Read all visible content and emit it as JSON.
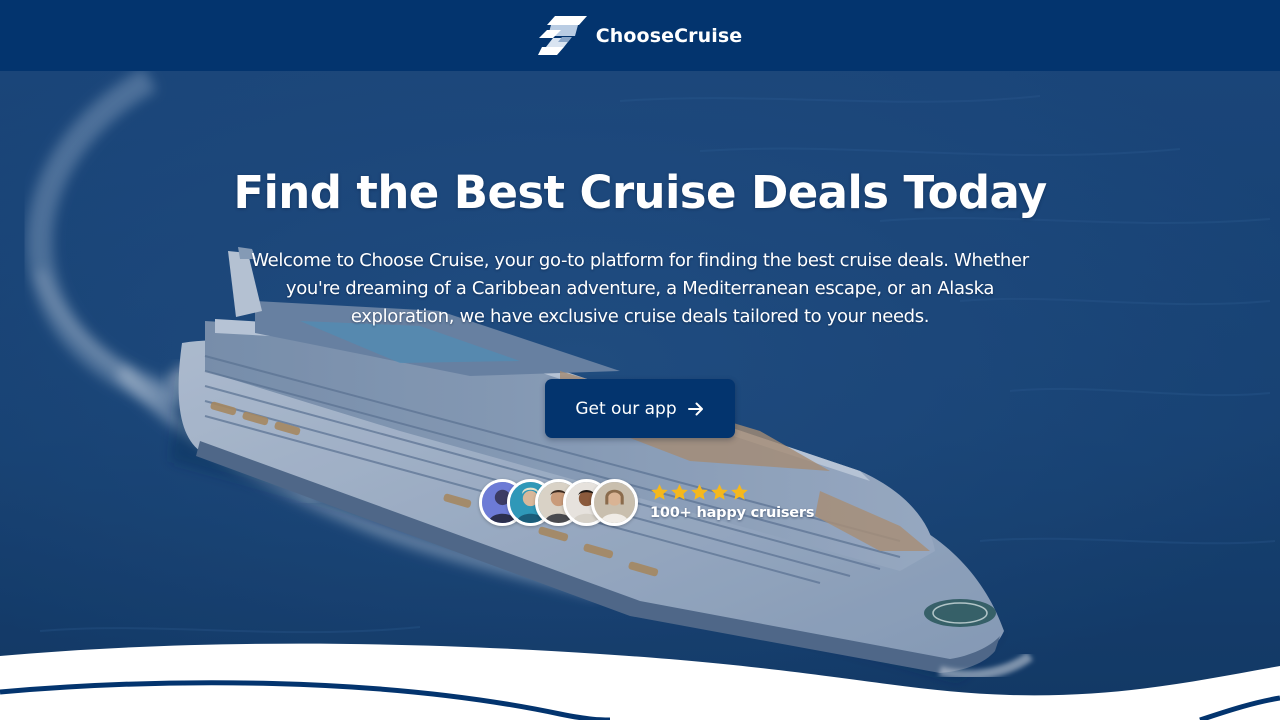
{
  "header": {
    "brand_name": "ChooseCruise",
    "logo_icon": "choosecruise-logo-icon",
    "background": "#03346e"
  },
  "hero": {
    "title": "Find the Best Cruise Deals Today",
    "description": "Welcome to Choose Cruise, your go-to platform for finding the best cruise deals. Whether you're dreaming of a Caribbean adventure, a Mediterranean escape, or an Alaska exploration, we have exclusive cruise deals tailored to your needs.",
    "cta": {
      "label": "Get our app",
      "icon": "arrow-right-icon"
    },
    "background_image": "cruise-ship-at-sea-photo"
  },
  "social_proof": {
    "avatars": [
      "avatar-1",
      "avatar-2",
      "avatar-3",
      "avatar-4",
      "avatar-5"
    ],
    "rating": 5,
    "rating_max": 5,
    "star_icon": "star-icon",
    "text": "100+ happy cruisers"
  },
  "colors": {
    "brand_navy": "#03346e",
    "star_gold": "#f5b81c",
    "white": "#ffffff"
  }
}
